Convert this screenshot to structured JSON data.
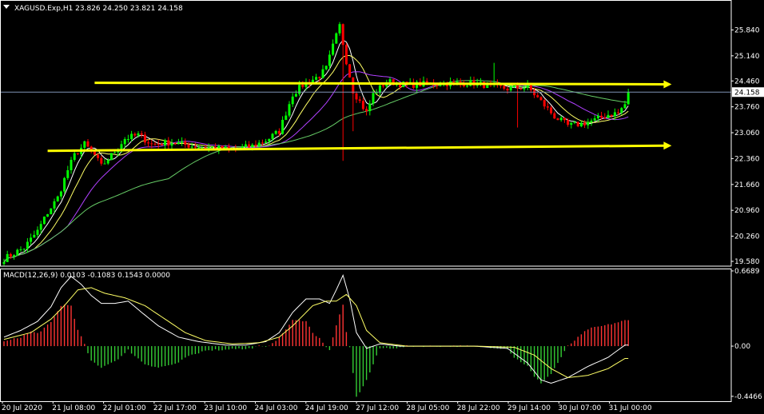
{
  "header": {
    "symbol_line": "XAGUSD.Exp,H1  23.826 24.250 23.821 24.158",
    "macd_line": "MACD(12,26,9) 0.0103 -0.1083 0.1543 0.0000"
  },
  "colors": {
    "background": "#000000",
    "frame": "#ffffff",
    "bull_candle": "#00ff00",
    "bear_candle": "#ff0000",
    "ma_fast": "#ffffff",
    "ma_mid": "#ffff66",
    "ma_slow_violet": "#b040ff",
    "ma_slow_green": "#66cc66",
    "trendline": "#ffff00",
    "price_line": "#7f93b4",
    "hist_up": "#ff3333",
    "hist_down": "#33cc33",
    "macd_main": "#ffffff",
    "macd_signal": "#ffff66"
  },
  "chart_data": [
    {
      "type": "candlestick",
      "title": "XAGUSD.Exp,H1",
      "ylim": [
        19.45,
        26.65
      ],
      "yticks": [
        "25.840",
        "25.140",
        "24.460",
        "23.760",
        "23.060",
        "22.360",
        "21.660",
        "20.960",
        "20.260",
        "19.580"
      ],
      "last_price": "24.158",
      "x_labels": [
        "20 Jul 2020",
        "21 Jul 08:00",
        "22 Jul 01:00",
        "22 Jul 17:00",
        "23 Jul 10:00",
        "24 Jul 03:00",
        "24 Jul 19:00",
        "27 Jul 12:00",
        "28 Jul 05:00",
        "28 Jul 22:00",
        "29 Jul 14:00",
        "30 Jul 07:00",
        "31 Jul 00:00"
      ],
      "close_path_keyframes": [
        [
          0,
          19.65
        ],
        [
          6,
          19.95
        ],
        [
          10,
          20.4
        ],
        [
          13,
          20.9
        ],
        [
          16,
          21.3
        ],
        [
          19,
          22.05
        ],
        [
          21,
          22.45
        ],
        [
          24,
          22.75
        ],
        [
          27,
          22.45
        ],
        [
          29,
          22.15
        ],
        [
          32,
          22.45
        ],
        [
          36,
          22.9
        ],
        [
          40,
          23.0
        ],
        [
          44,
          22.75
        ],
        [
          50,
          22.8
        ],
        [
          56,
          22.7
        ],
        [
          62,
          22.65
        ],
        [
          68,
          22.6
        ],
        [
          74,
          22.7
        ],
        [
          78,
          22.85
        ],
        [
          82,
          23.1
        ],
        [
          84,
          23.6
        ],
        [
          86,
          24.1
        ],
        [
          89,
          24.35
        ],
        [
          92,
          24.5
        ],
        [
          94,
          24.6
        ],
        [
          96,
          24.8
        ],
        [
          98,
          25.4
        ],
        [
          100,
          25.95
        ],
        [
          102,
          25.0
        ],
        [
          104,
          24.2
        ],
        [
          106,
          23.9
        ],
        [
          108,
          23.6
        ],
        [
          110,
          24.1
        ],
        [
          114,
          24.45
        ],
        [
          120,
          24.35
        ],
        [
          130,
          24.4
        ],
        [
          140,
          24.4
        ],
        [
          150,
          24.25
        ],
        [
          156,
          24.3
        ],
        [
          160,
          23.9
        ],
        [
          164,
          23.5
        ],
        [
          168,
          23.25
        ],
        [
          172,
          23.3
        ],
        [
          176,
          23.4
        ],
        [
          180,
          23.55
        ],
        [
          183,
          23.6
        ],
        [
          185,
          23.83
        ]
      ],
      "last_candle": {
        "open": 23.826,
        "high": 24.25,
        "low": 23.821,
        "close": 24.158
      },
      "spikes": [
        {
          "bar": 101,
          "low": 22.3
        },
        {
          "bar": 104,
          "low": 23.1
        },
        {
          "bar": 146,
          "high": 24.95
        },
        {
          "bar": 153,
          "low": 23.2
        }
      ],
      "horizontal_lines": [
        {
          "name": "resistance-trendline",
          "from": [
            27,
            24.41
          ],
          "to": [
            197,
            24.37
          ],
          "arrow": true
        },
        {
          "name": "support-trendline",
          "from": [
            13,
            22.57
          ],
          "to": [
            197,
            22.71
          ],
          "arrow": true
        }
      ],
      "moving_averages": [
        {
          "name": "fast",
          "period": 5
        },
        {
          "name": "mid",
          "period": 10
        },
        {
          "name": "slow-violet",
          "period": 20
        },
        {
          "name": "slow-green",
          "period": 50
        }
      ]
    },
    {
      "type": "macd",
      "title": "MACD(12,26,9)",
      "ylim": [
        -0.49,
        0.69
      ],
      "yticks": [
        "0.6689",
        "0.00",
        "-0.4466"
      ],
      "values": {
        "macd": 0.0103,
        "signal": -0.1083,
        "hist": 0.1543
      },
      "macd_keyframes": [
        [
          0,
          0.08
        ],
        [
          5,
          0.14
        ],
        [
          10,
          0.22
        ],
        [
          14,
          0.35
        ],
        [
          17,
          0.52
        ],
        [
          20,
          0.62
        ],
        [
          23,
          0.55
        ],
        [
          26,
          0.45
        ],
        [
          29,
          0.38
        ],
        [
          33,
          0.38
        ],
        [
          37,
          0.4
        ],
        [
          41,
          0.3
        ],
        [
          46,
          0.18
        ],
        [
          52,
          0.08
        ],
        [
          58,
          0.04
        ],
        [
          66,
          0.01
        ],
        [
          72,
          0.01
        ],
        [
          78,
          0.04
        ],
        [
          82,
          0.12
        ],
        [
          86,
          0.3
        ],
        [
          90,
          0.42
        ],
        [
          94,
          0.42
        ],
        [
          97,
          0.38
        ],
        [
          99,
          0.5
        ],
        [
          101,
          0.63
        ],
        [
          103,
          0.42
        ],
        [
          105,
          0.12
        ],
        [
          108,
          -0.02
        ],
        [
          112,
          0.02
        ],
        [
          118,
          0.0
        ],
        [
          130,
          0.0
        ],
        [
          140,
          0.0
        ],
        [
          150,
          -0.02
        ],
        [
          156,
          -0.15
        ],
        [
          160,
          -0.3
        ],
        [
          163,
          -0.33
        ],
        [
          168,
          -0.28
        ],
        [
          174,
          -0.18
        ],
        [
          180,
          -0.1
        ],
        [
          185,
          0.01
        ]
      ],
      "signal_keyframes": [
        [
          0,
          0.06
        ],
        [
          8,
          0.12
        ],
        [
          14,
          0.24
        ],
        [
          18,
          0.36
        ],
        [
          22,
          0.5
        ],
        [
          26,
          0.52
        ],
        [
          30,
          0.47
        ],
        [
          36,
          0.43
        ],
        [
          42,
          0.36
        ],
        [
          48,
          0.24
        ],
        [
          54,
          0.12
        ],
        [
          60,
          0.05
        ],
        [
          68,
          0.02
        ],
        [
          76,
          0.03
        ],
        [
          82,
          0.08
        ],
        [
          86,
          0.18
        ],
        [
          92,
          0.36
        ],
        [
          96,
          0.4
        ],
        [
          99,
          0.4
        ],
        [
          102,
          0.46
        ],
        [
          105,
          0.36
        ],
        [
          108,
          0.14
        ],
        [
          112,
          0.03
        ],
        [
          120,
          0.0
        ],
        [
          140,
          0.0
        ],
        [
          152,
          -0.01
        ],
        [
          158,
          -0.08
        ],
        [
          163,
          -0.2
        ],
        [
          168,
          -0.28
        ],
        [
          174,
          -0.26
        ],
        [
          180,
          -0.2
        ],
        [
          185,
          -0.11
        ]
      ]
    }
  ]
}
